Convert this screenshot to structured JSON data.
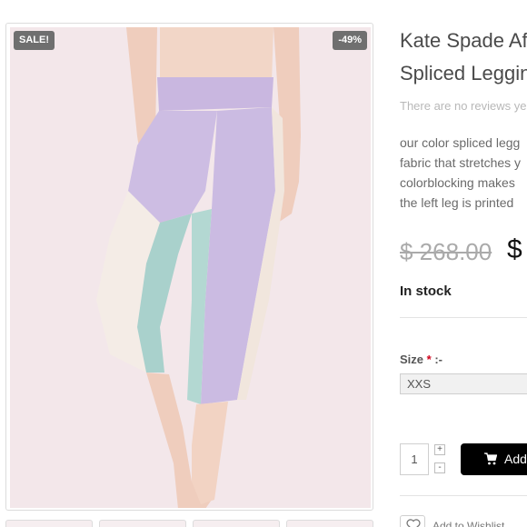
{
  "gallery": {
    "sale_badge": "SALE!",
    "discount_badge": "-49%",
    "image_alt": "Kate Spade Af Spliced Leggings"
  },
  "product": {
    "title_line1": "Kate Spade Af",
    "title_line2": "Spliced Leggin",
    "reviews": "There are no reviews ye",
    "description_lines": [
      "our color spliced legg",
      "fabric that stretches y",
      "colorblocking makes",
      "the left leg is printed"
    ],
    "old_price": "$ 268.00",
    "new_price": "$",
    "stock_status": "In stock",
    "size_label": "Size",
    "size_required": "*",
    "size_suffix": " :-",
    "size_selected": "XXS",
    "quantity": "1",
    "qty_plus": "+",
    "qty_minus": "-",
    "add_to_cart": "Add",
    "wishlist": "Add to Wishlist"
  },
  "icons": {
    "cart": "cart-icon",
    "wishlist": "heart-icon"
  },
  "colors": {
    "badge": "#6f6f6f",
    "button": "#000000",
    "required": "#d0021b",
    "legging_lavender": "#cdbde3",
    "legging_mint": "#a9d1cc",
    "legging_cream": "#f4ece6"
  }
}
